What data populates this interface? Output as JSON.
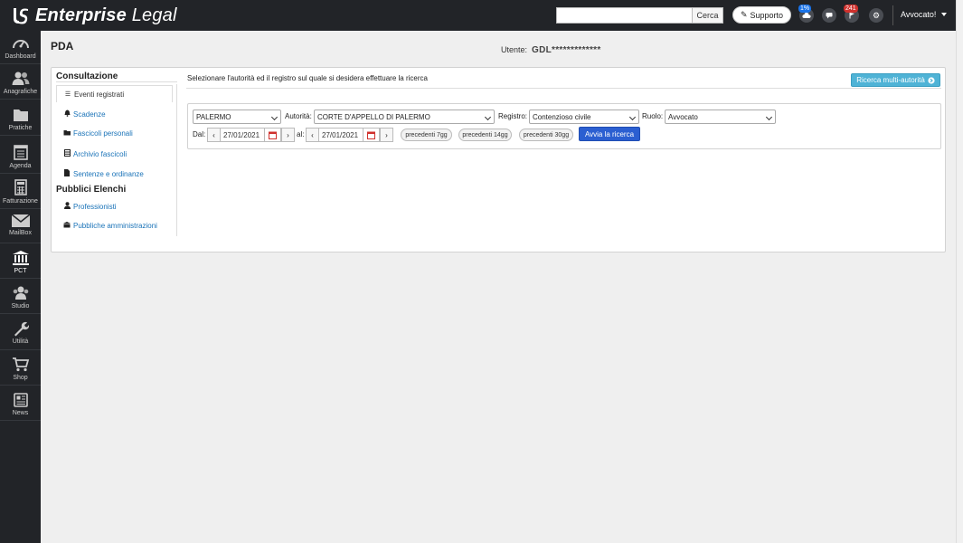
{
  "app": {
    "name_bold": "Enterprise",
    "name_light": " Legal"
  },
  "header": {
    "search_placeholder": "",
    "search_button": "Cerca",
    "support_button": "Supporto",
    "cloud_badge": "1%",
    "notification_badge": "241",
    "user_menu": "Avvocato!"
  },
  "sidebar": {
    "items": [
      {
        "label": "Dashboard",
        "icon": "gauge-icon"
      },
      {
        "label": "Anagrafiche",
        "icon": "users-icon"
      },
      {
        "label": "Pratiche",
        "icon": "folder-icon"
      },
      {
        "label": "Agenda",
        "icon": "calendar-icon"
      },
      {
        "label": "Fatturazione",
        "icon": "calculator-icon"
      },
      {
        "label": "MailBox",
        "icon": "envelope-icon"
      },
      {
        "label": "PCT",
        "icon": "courthouse-icon"
      },
      {
        "label": "Studio",
        "icon": "group-icon"
      },
      {
        "label": "Utilità",
        "icon": "wrench-icon"
      },
      {
        "label": "Shop",
        "icon": "cart-icon"
      },
      {
        "label": "News",
        "icon": "newspaper-icon"
      }
    ]
  },
  "page": {
    "title": "PDA",
    "user_label": "Utente:",
    "user_value": "GDL*************"
  },
  "menu": {
    "consultazione_title": "Consultazione",
    "consultazione": [
      {
        "label": "Eventi registrati",
        "icon": "list-icon"
      },
      {
        "label": "Scadenze",
        "icon": "bell-icon"
      },
      {
        "label": "Fascicoli personali",
        "icon": "folder-open-icon"
      },
      {
        "label": "Archivio fascicoli",
        "icon": "archive-icon"
      },
      {
        "label": "Sentenze e ordinanze",
        "icon": "document-icon"
      }
    ],
    "elenchi_title": "Pubblici Elenchi",
    "elenchi": [
      {
        "label": "Professionisti",
        "icon": "person-icon"
      },
      {
        "label": "Pubbliche amministrazioni",
        "icon": "building-icon"
      }
    ]
  },
  "form": {
    "instruction": "Selezionare l'autorità ed il registro sul quale si desidera effettuare la ricerca",
    "multi_button": "Ricerca multi-autorità",
    "city_value": "PALERMO",
    "autorita_label": "Autorità:",
    "autorita_value": "CORTE D'APPELLO DI PALERMO",
    "registro_label": "Registro:",
    "registro_value": "Contenzioso civile",
    "ruolo_label": "Ruolo:",
    "ruolo_value": "Avvocato",
    "dal_label": "Dal:",
    "dal_value": "27/01/2021",
    "al_label": "al:",
    "al_value": "27/01/2021",
    "prev7": "precedenti 7gg",
    "prev14": "precedenti 14gg",
    "prev30": "precedenti 30gg",
    "submit": "Avvia la ricerca"
  },
  "colors": {
    "topbar": "#222428",
    "link": "#1a73b8",
    "primary_button": "#2b5fd1",
    "info_button": "#4fb3d6",
    "badge_red": "#d0312d",
    "badge_blue": "#1a73e8"
  }
}
